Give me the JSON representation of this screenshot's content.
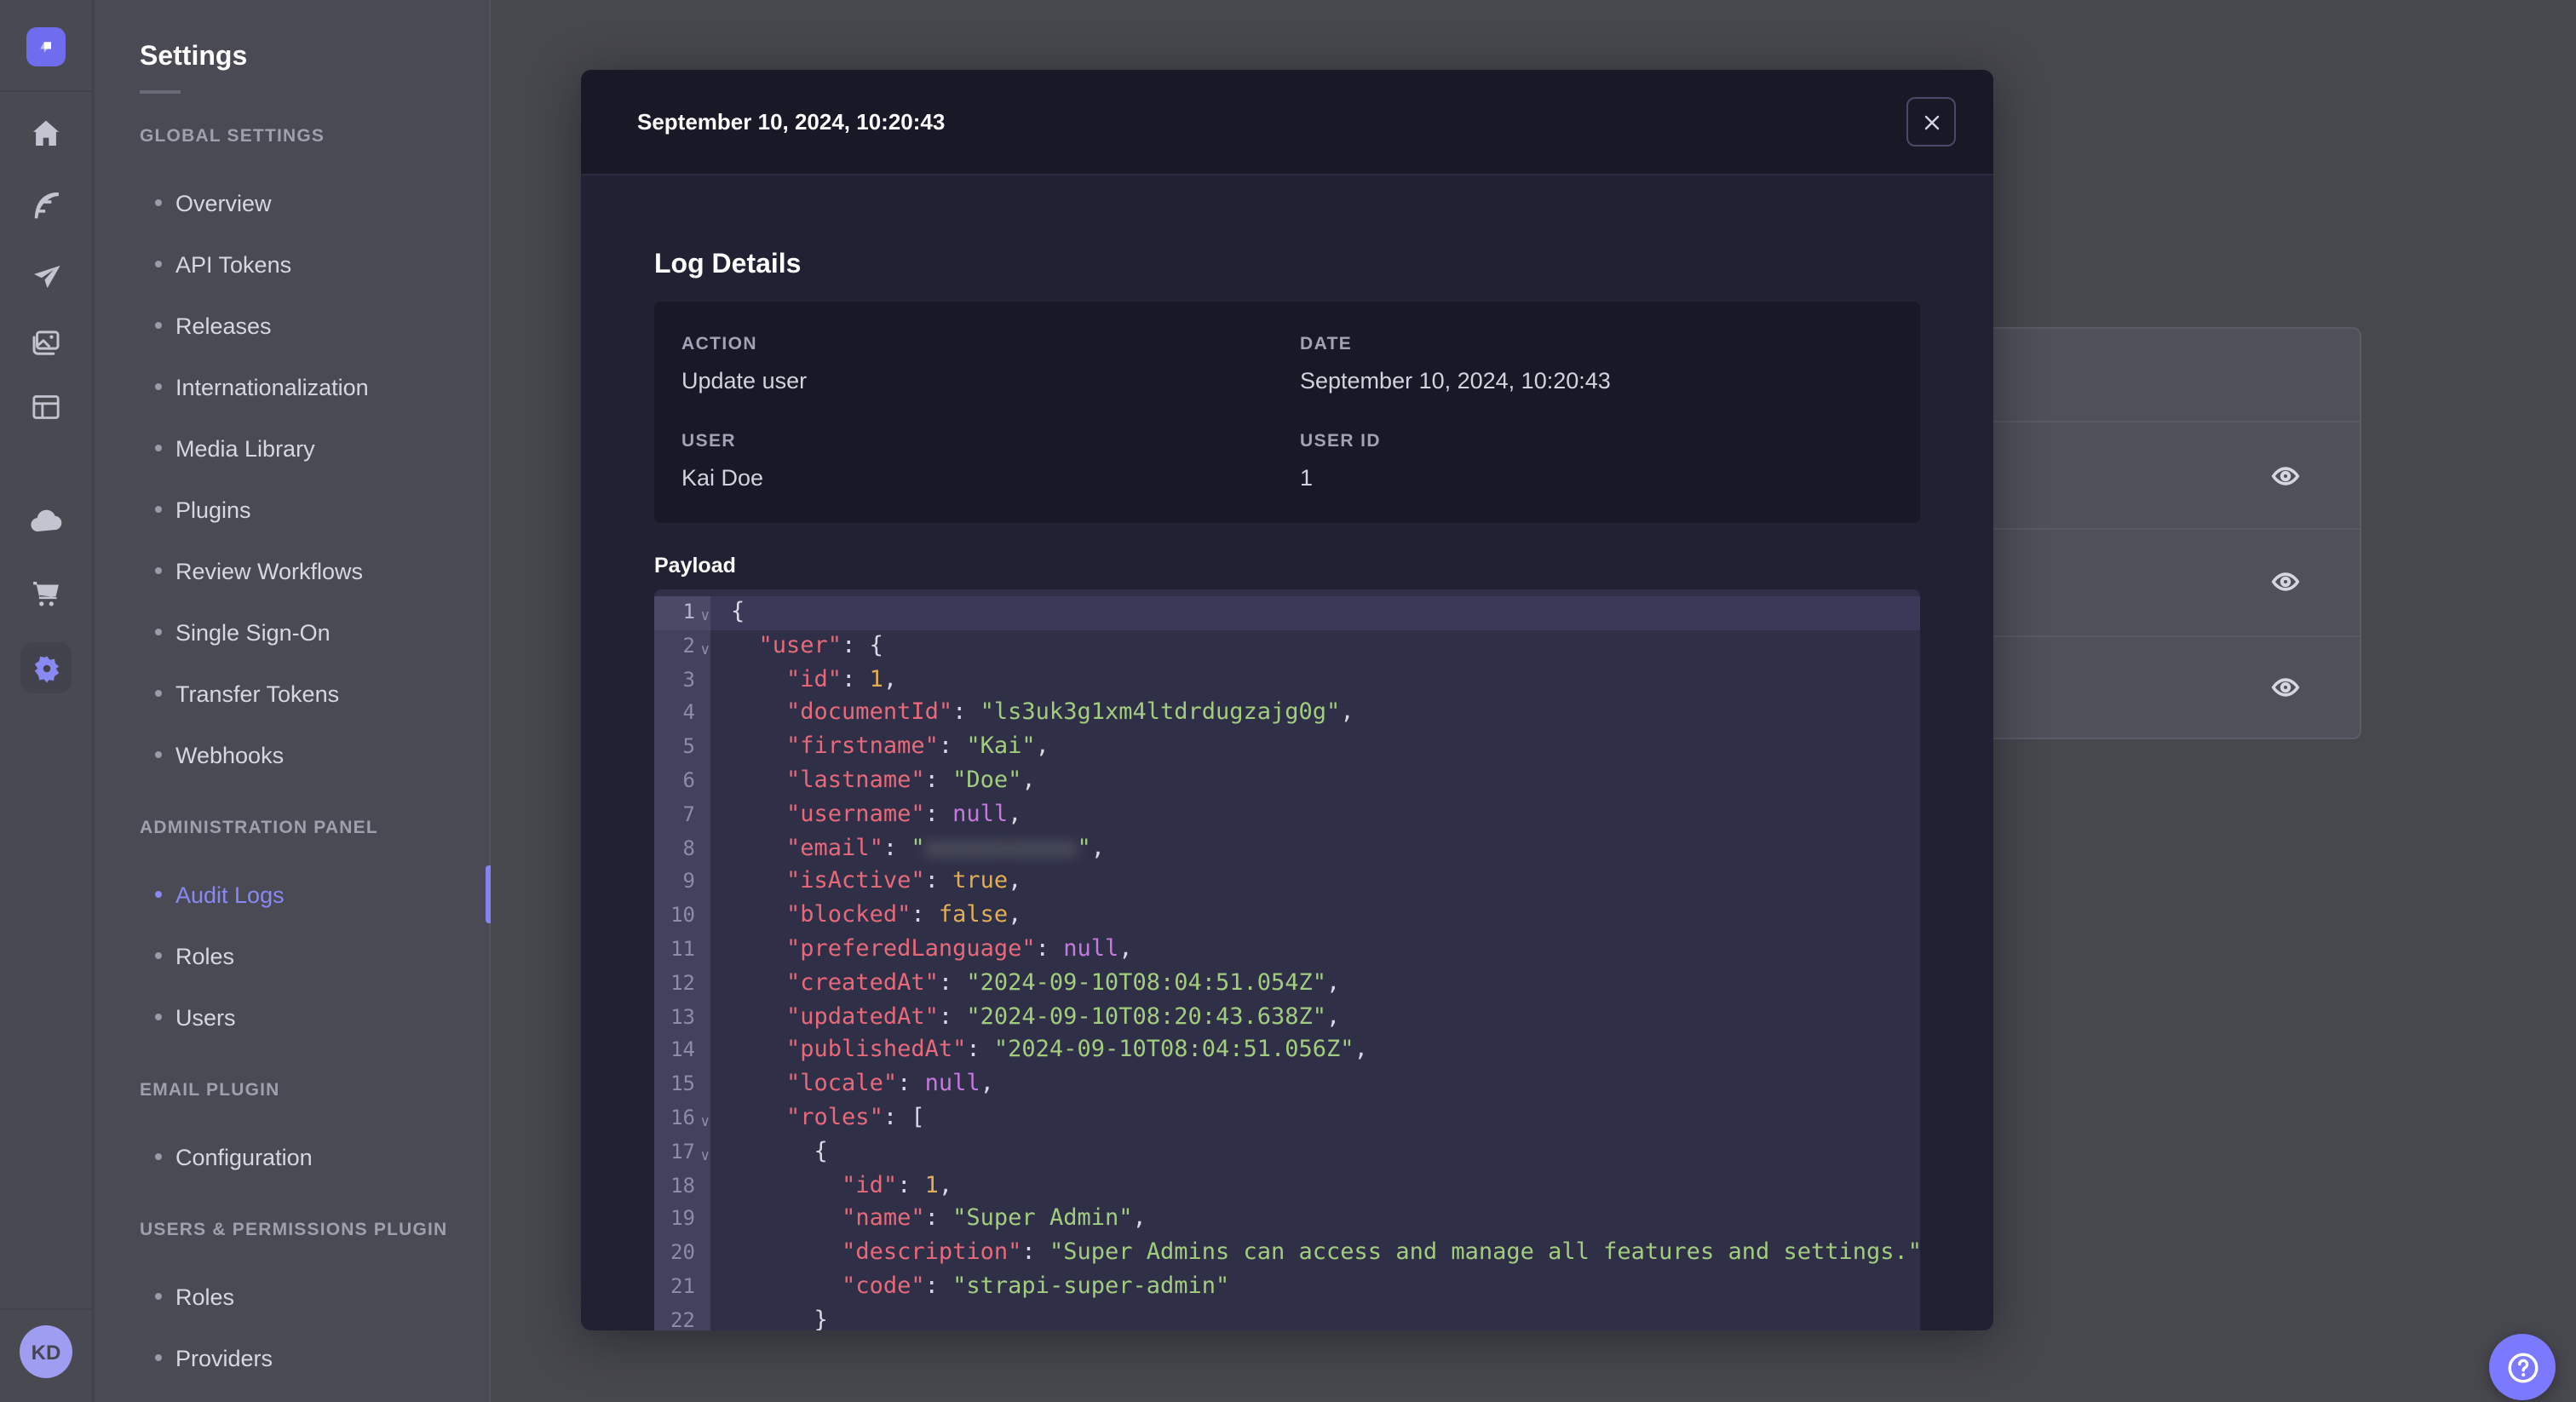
{
  "colors": {
    "accent_purple": "#7b79ff",
    "nav_active": "#8a88f2",
    "modal_bg": "#212134",
    "modal_header_bg": "#181826",
    "code_bg": "#2f2f48",
    "syntax_key": "#e8697a",
    "syntax_string": "#a3cd7e",
    "syntax_number": "#e2ae55",
    "syntax_null": "#c678dd"
  },
  "sidebar": {
    "icons": [
      "strapi-logo",
      "home-icon",
      "content-builder-icon",
      "deploy-icon",
      "media-library-icon",
      "content-manager-icon",
      "cloud-icon",
      "marketplace-icon",
      "settings-icon"
    ],
    "user_initials": "KD"
  },
  "settings_nav": {
    "title": "Settings",
    "sections": [
      {
        "header": "GLOBAL SETTINGS",
        "items": [
          {
            "label": "Overview",
            "active": false
          },
          {
            "label": "API Tokens",
            "active": false
          },
          {
            "label": "Releases",
            "active": false
          },
          {
            "label": "Internationalization",
            "active": false
          },
          {
            "label": "Media Library",
            "active": false
          },
          {
            "label": "Plugins",
            "active": false
          },
          {
            "label": "Review Workflows",
            "active": false
          },
          {
            "label": "Single Sign-On",
            "active": false
          },
          {
            "label": "Transfer Tokens",
            "active": false
          },
          {
            "label": "Webhooks",
            "active": false
          }
        ]
      },
      {
        "header": "ADMINISTRATION PANEL",
        "items": [
          {
            "label": "Audit Logs",
            "active": true
          },
          {
            "label": "Roles",
            "active": false
          },
          {
            "label": "Users",
            "active": false
          }
        ]
      },
      {
        "header": "EMAIL PLUGIN",
        "items": [
          {
            "label": "Configuration",
            "active": false
          }
        ]
      },
      {
        "header": "USERS & PERMISSIONS PLUGIN",
        "items": [
          {
            "label": "Roles",
            "active": false
          },
          {
            "label": "Providers",
            "active": false
          }
        ]
      }
    ]
  },
  "background_table": {
    "row_count": 3,
    "action_icon": "eye-icon"
  },
  "modal": {
    "header": {
      "title": "September 10, 2024, 10:20:43",
      "close_icon": "x-icon"
    },
    "section_title": "Log Details",
    "details": {
      "fields": [
        {
          "label": "ACTION",
          "value": "Update user"
        },
        {
          "label": "DATE",
          "value": "September 10, 2024, 10:20:43"
        },
        {
          "label": "USER",
          "value": "Kai Doe"
        },
        {
          "label": "USER ID",
          "value": "1"
        }
      ]
    },
    "payload_label": "Payload",
    "code": {
      "lines": [
        {
          "n": 1,
          "fold": true,
          "active": true,
          "tokens": [
            {
              "c": "p",
              "t": "{"
            }
          ]
        },
        {
          "n": 2,
          "fold": true,
          "tokens": [
            {
              "c": "p",
              "t": "  "
            },
            {
              "c": "key",
              "t": "\"user\""
            },
            {
              "c": "p",
              "t": ": {"
            }
          ]
        },
        {
          "n": 3,
          "tokens": [
            {
              "c": "p",
              "t": "    "
            },
            {
              "c": "key",
              "t": "\"id\""
            },
            {
              "c": "p",
              "t": ": "
            },
            {
              "c": "num",
              "t": "1"
            },
            {
              "c": "p",
              "t": ","
            }
          ]
        },
        {
          "n": 4,
          "tokens": [
            {
              "c": "p",
              "t": "    "
            },
            {
              "c": "key",
              "t": "\"documentId\""
            },
            {
              "c": "p",
              "t": ": "
            },
            {
              "c": "str",
              "t": "\"ls3uk3g1xm4ltdrdugzajg0g\""
            },
            {
              "c": "p",
              "t": ","
            }
          ]
        },
        {
          "n": 5,
          "tokens": [
            {
              "c": "p",
              "t": "    "
            },
            {
              "c": "key",
              "t": "\"firstname\""
            },
            {
              "c": "p",
              "t": ": "
            },
            {
              "c": "str",
              "t": "\"Kai\""
            },
            {
              "c": "p",
              "t": ","
            }
          ]
        },
        {
          "n": 6,
          "tokens": [
            {
              "c": "p",
              "t": "    "
            },
            {
              "c": "key",
              "t": "\"lastname\""
            },
            {
              "c": "p",
              "t": ": "
            },
            {
              "c": "str",
              "t": "\"Doe\""
            },
            {
              "c": "p",
              "t": ","
            }
          ]
        },
        {
          "n": 7,
          "tokens": [
            {
              "c": "p",
              "t": "    "
            },
            {
              "c": "key",
              "t": "\"username\""
            },
            {
              "c": "p",
              "t": ": "
            },
            {
              "c": "kw",
              "t": "null"
            },
            {
              "c": "p",
              "t": ","
            }
          ]
        },
        {
          "n": 8,
          "tokens": [
            {
              "c": "p",
              "t": "    "
            },
            {
              "c": "key",
              "t": "\"email\""
            },
            {
              "c": "p",
              "t": ": "
            },
            {
              "c": "str",
              "t": "\""
            },
            {
              "c": "blur",
              "t": "xxxxxxxxxxx"
            },
            {
              "c": "str",
              "t": "\""
            },
            {
              "c": "p",
              "t": ","
            }
          ]
        },
        {
          "n": 9,
          "tokens": [
            {
              "c": "p",
              "t": "    "
            },
            {
              "c": "key",
              "t": "\"isActive\""
            },
            {
              "c": "p",
              "t": ": "
            },
            {
              "c": "num",
              "t": "true"
            },
            {
              "c": "p",
              "t": ","
            }
          ]
        },
        {
          "n": 10,
          "tokens": [
            {
              "c": "p",
              "t": "    "
            },
            {
              "c": "key",
              "t": "\"blocked\""
            },
            {
              "c": "p",
              "t": ": "
            },
            {
              "c": "num",
              "t": "false"
            },
            {
              "c": "p",
              "t": ","
            }
          ]
        },
        {
          "n": 11,
          "tokens": [
            {
              "c": "p",
              "t": "    "
            },
            {
              "c": "key",
              "t": "\"preferedLanguage\""
            },
            {
              "c": "p",
              "t": ": "
            },
            {
              "c": "kw",
              "t": "null"
            },
            {
              "c": "p",
              "t": ","
            }
          ]
        },
        {
          "n": 12,
          "tokens": [
            {
              "c": "p",
              "t": "    "
            },
            {
              "c": "key",
              "t": "\"createdAt\""
            },
            {
              "c": "p",
              "t": ": "
            },
            {
              "c": "str",
              "t": "\"2024-09-10T08:04:51.054Z\""
            },
            {
              "c": "p",
              "t": ","
            }
          ]
        },
        {
          "n": 13,
          "tokens": [
            {
              "c": "p",
              "t": "    "
            },
            {
              "c": "key",
              "t": "\"updatedAt\""
            },
            {
              "c": "p",
              "t": ": "
            },
            {
              "c": "str",
              "t": "\"2024-09-10T08:20:43.638Z\""
            },
            {
              "c": "p",
              "t": ","
            }
          ]
        },
        {
          "n": 14,
          "tokens": [
            {
              "c": "p",
              "t": "    "
            },
            {
              "c": "key",
              "t": "\"publishedAt\""
            },
            {
              "c": "p",
              "t": ": "
            },
            {
              "c": "str",
              "t": "\"2024-09-10T08:04:51.056Z\""
            },
            {
              "c": "p",
              "t": ","
            }
          ]
        },
        {
          "n": 15,
          "tokens": [
            {
              "c": "p",
              "t": "    "
            },
            {
              "c": "key",
              "t": "\"locale\""
            },
            {
              "c": "p",
              "t": ": "
            },
            {
              "c": "kw",
              "t": "null"
            },
            {
              "c": "p",
              "t": ","
            }
          ]
        },
        {
          "n": 16,
          "fold": true,
          "tokens": [
            {
              "c": "p",
              "t": "    "
            },
            {
              "c": "key",
              "t": "\"roles\""
            },
            {
              "c": "p",
              "t": ": ["
            }
          ]
        },
        {
          "n": 17,
          "fold": true,
          "tokens": [
            {
              "c": "p",
              "t": "      {"
            }
          ]
        },
        {
          "n": 18,
          "tokens": [
            {
              "c": "p",
              "t": "        "
            },
            {
              "c": "key",
              "t": "\"id\""
            },
            {
              "c": "p",
              "t": ": "
            },
            {
              "c": "num",
              "t": "1"
            },
            {
              "c": "p",
              "t": ","
            }
          ]
        },
        {
          "n": 19,
          "tokens": [
            {
              "c": "p",
              "t": "        "
            },
            {
              "c": "key",
              "t": "\"name\""
            },
            {
              "c": "p",
              "t": ": "
            },
            {
              "c": "str",
              "t": "\"Super Admin\""
            },
            {
              "c": "p",
              "t": ","
            }
          ]
        },
        {
          "n": 20,
          "tokens": [
            {
              "c": "p",
              "t": "        "
            },
            {
              "c": "key",
              "t": "\"description\""
            },
            {
              "c": "p",
              "t": ": "
            },
            {
              "c": "str",
              "t": "\"Super Admins can access and manage all features and settings.\""
            },
            {
              "c": "p",
              "t": ","
            }
          ]
        },
        {
          "n": 21,
          "tokens": [
            {
              "c": "p",
              "t": "        "
            },
            {
              "c": "key",
              "t": "\"code\""
            },
            {
              "c": "p",
              "t": ": "
            },
            {
              "c": "str",
              "t": "\"strapi-super-admin\""
            }
          ]
        },
        {
          "n": 22,
          "tokens": [
            {
              "c": "p",
              "t": "      }"
            }
          ]
        }
      ]
    }
  },
  "help": {
    "icon": "question-mark-icon"
  }
}
